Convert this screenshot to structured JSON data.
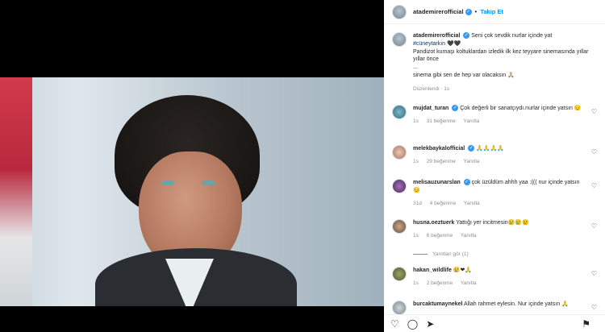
{
  "post": {
    "username": "atademirerofficial",
    "follow_label": "Takip Et",
    "caption": {
      "text": "Seni çok sevdik nurlar içinde yat",
      "hashtag": "#cüneytarkın",
      "hashtag_suffix": " 🖤🖤",
      "line2": "Pandizot kumaşı koltuklardan izledik ilk kez teyyare sinemasında yıllar yıllar önce",
      "line3": "...",
      "line4": "sinema gibi sen de hep var olacaksın 🙏🏼",
      "meta": "Düzenlendi · 1s"
    }
  },
  "comments": [
    {
      "username": "mujdat_turan",
      "text": "Çok değerli bir sanatçıydı.nurlar içinde yatsın 😔",
      "time": "1s",
      "likes": "31 beğenme",
      "reply": "Yanıtla",
      "verified": true
    },
    {
      "username": "melekbaykalofficial",
      "text": "🙏🙏🙏🙏",
      "time": "1s",
      "likes": "29 beğenme",
      "reply": "Yanıtla",
      "verified": true
    },
    {
      "username": "melisauzunarslan",
      "text": "çok üzüldüm ahhh yaa :((( nur içinde yatsın 😔",
      "time": "31d",
      "likes": "4 beğenme",
      "reply": "Yanıtla",
      "verified": true
    },
    {
      "username": "husna.oeztuerk",
      "text": "Yattığı yer incitmesin😢😢😢",
      "time": "1s",
      "likes": "6 beğenme",
      "reply": "Yanıtla",
      "verified": false
    },
    {
      "username": "hakan_wildlife",
      "text": "😢❤🙏",
      "time": "1s",
      "likes": "2 beğenme",
      "reply": "Yanıtla",
      "verified": false
    },
    {
      "username": "burcaktumaynekel",
      "text": "Allah rahmet eylesin. Nur içinde yatsın 🙏",
      "time": "",
      "likes": "",
      "reply": "",
      "verified": false
    }
  ],
  "view_replies": "Yanıtları gör (1)",
  "icons": {
    "heart": "heart-icon",
    "comment": "comment-icon",
    "share": "share-icon",
    "save": "bookmark-icon"
  },
  "colors": {
    "accent": "#0095f6",
    "verified": "#3897f0",
    "muted": "#8e8e8e"
  }
}
